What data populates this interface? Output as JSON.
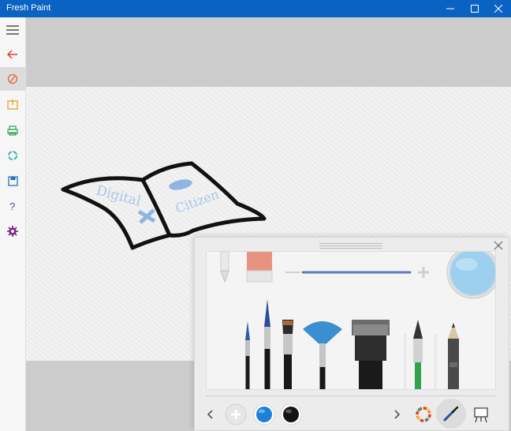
{
  "window": {
    "title": "Fresh Paint",
    "controls": [
      "minimize-icon",
      "maximize-icon",
      "close-icon"
    ]
  },
  "sidebar": {
    "items": [
      {
        "name": "menu",
        "icon": "hamburger-menu-icon"
      },
      {
        "name": "back",
        "icon": "back-arrow-icon"
      },
      {
        "name": "paint",
        "icon": "brush-circle-icon",
        "selected": true
      },
      {
        "name": "import",
        "icon": "import-picture-icon"
      },
      {
        "name": "print",
        "icon": "printer-icon"
      },
      {
        "name": "share",
        "icon": "share-icon"
      },
      {
        "name": "save",
        "icon": "save-icon"
      },
      {
        "name": "help",
        "icon": "help-icon"
      },
      {
        "name": "settings",
        "icon": "gear-icon"
      }
    ]
  },
  "canvas": {
    "drawing_words": [
      "Digital",
      "Citizen"
    ],
    "ink_color": "#111111",
    "watercolor": "#8fb6e0"
  },
  "palette": {
    "tools": [
      "pen-nib-icon",
      "eraser-icon",
      "brush-size-slider",
      "mixer-plate"
    ],
    "brushes": [
      "thin-brush",
      "round-brush",
      "flat-brush",
      "fan-brush",
      "wide-flat-brush",
      "watercolor-brush",
      "pencil"
    ],
    "colors": [
      {
        "name": "add-color",
        "hex": "#e6e6e6"
      },
      {
        "name": "blue",
        "hex": "#1e7fd8"
      },
      {
        "name": "black",
        "hex": "#141414"
      }
    ],
    "bottom_icons": [
      "prev-chevron-icon",
      "next-chevron-icon",
      "color-wheel-icon",
      "brush-mode-icon",
      "easel-icon"
    ]
  }
}
